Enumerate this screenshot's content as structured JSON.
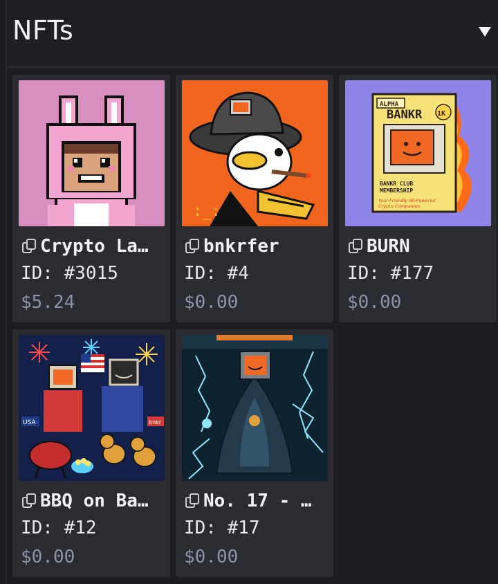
{
  "header": {
    "title": "NFTs",
    "toggle_icon": "triangle-down-icon"
  },
  "colors": {
    "background": "#1c1d21",
    "card": "#2a2c31",
    "price_text": "#8d93a8"
  },
  "nfts": [
    {
      "name": "Crypto La…",
      "id": "ID: #3015",
      "price": "$5.24",
      "icon": "copy-icon"
    },
    {
      "name": "bnkrfer",
      "id": "ID: #4",
      "price": "$0.00",
      "icon": "copy-icon"
    },
    {
      "name": "BURN",
      "id": "ID: #177",
      "price": "$0.00",
      "icon": "copy-icon"
    },
    {
      "name": "BBQ on Ba…",
      "id": "ID: #12",
      "price": "$0.00",
      "icon": "copy-icon"
    },
    {
      "name": "No. 17 - …",
      "id": "ID: #17",
      "price": "$0.00",
      "icon": "copy-icon"
    }
  ],
  "artwork_text": {
    "burn_card": {
      "badge": "ALPHA",
      "brand": "BANKR",
      "tag": "1K",
      "line1": "BANKR CLUB",
      "line2": "MEMBERSHIP",
      "line3": "Your-Friendly All-Powered",
      "line4": "Crypto Companion"
    },
    "bbq_left_sign": "USA",
    "bbq_right_sign": "bnkr"
  }
}
